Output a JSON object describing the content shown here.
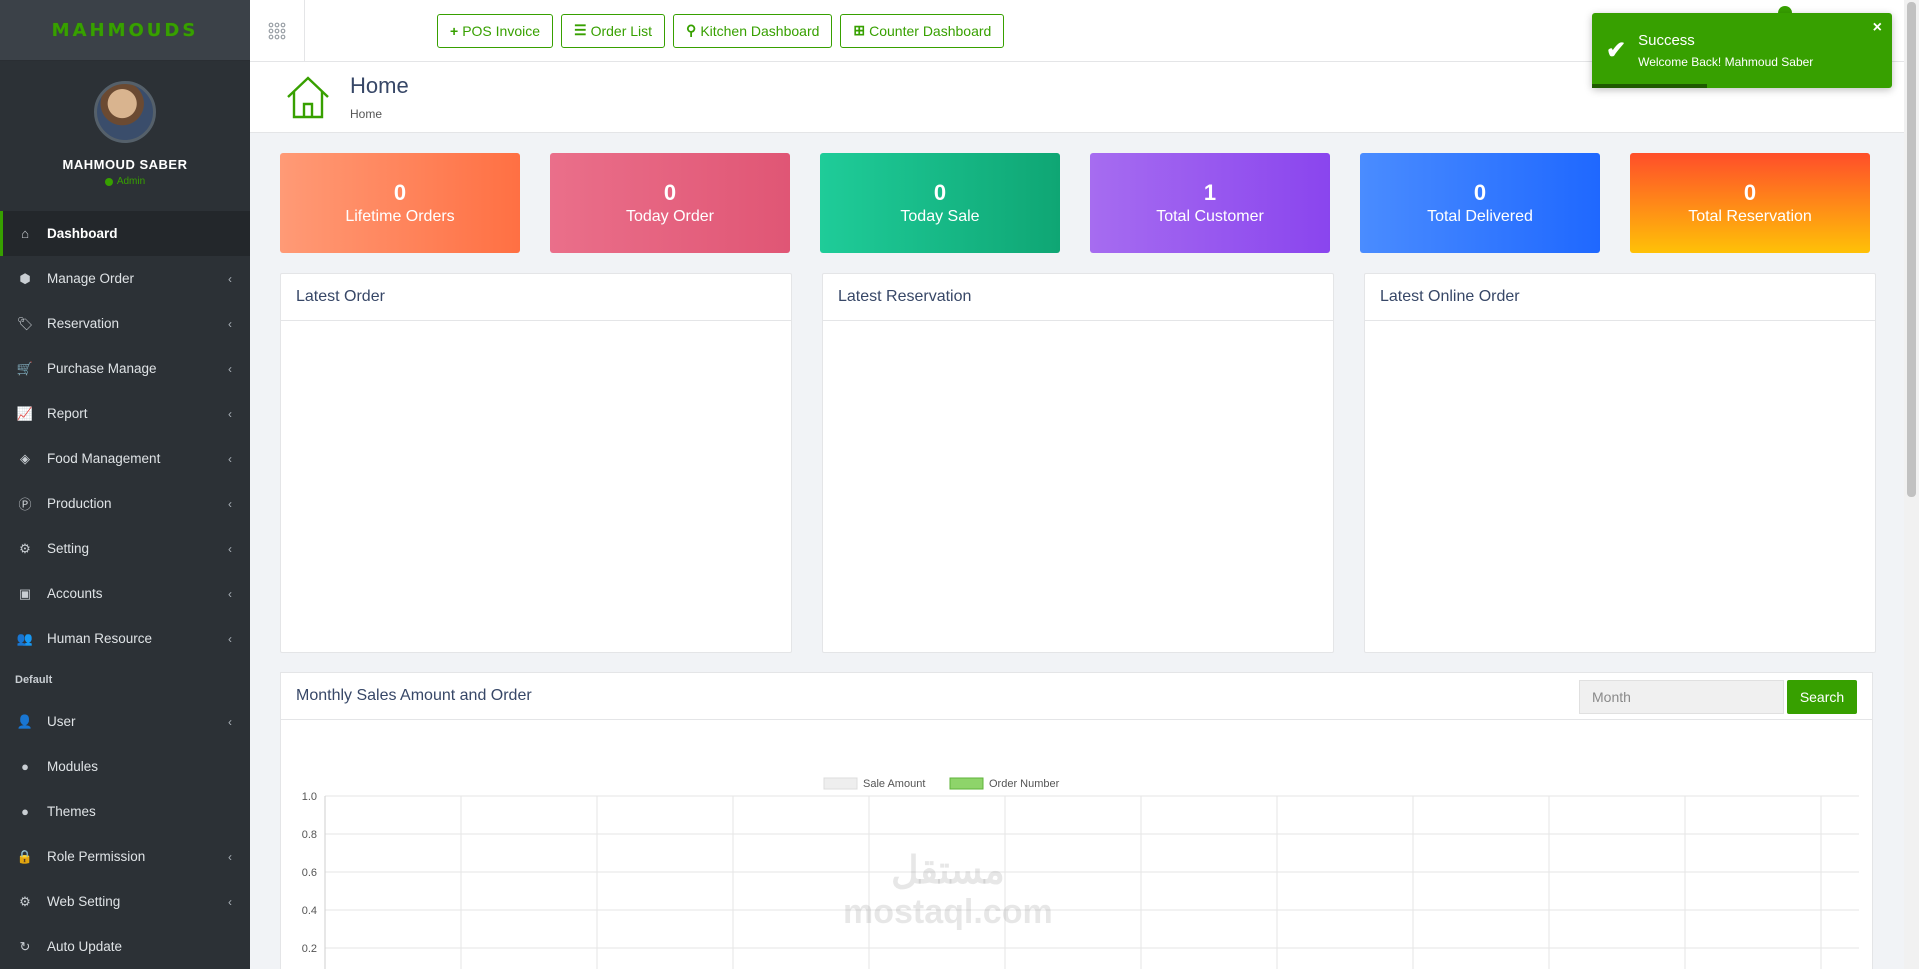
{
  "brand": {
    "logo": "MAHMOUDS"
  },
  "user": {
    "name": "MAHMOUD SABER",
    "role": "Admin"
  },
  "sidebar": {
    "items": [
      {
        "label": "Dashboard",
        "icon": "home-icon",
        "glyph": "⌂",
        "chevron": false,
        "active": true
      },
      {
        "label": "Manage Order",
        "icon": "box-icon",
        "glyph": "⬢",
        "chevron": true
      },
      {
        "label": "Reservation",
        "icon": "tags-icon",
        "glyph": "🏷",
        "chevron": true
      },
      {
        "label": "Purchase Manage",
        "icon": "cart-icon",
        "glyph": "🛒",
        "chevron": true
      },
      {
        "label": "Report",
        "icon": "line-chart-icon",
        "glyph": "📈",
        "chevron": true
      },
      {
        "label": "Food Management",
        "icon": "cube-icon",
        "glyph": "◈",
        "chevron": true
      },
      {
        "label": "Production",
        "icon": "production-icon",
        "glyph": "Ⓟ",
        "chevron": true
      },
      {
        "label": "Setting",
        "icon": "gear-icon",
        "glyph": "⚙",
        "chevron": true
      },
      {
        "label": "Accounts",
        "icon": "briefcase-icon",
        "glyph": "▣",
        "chevron": true
      },
      {
        "label": "Human Resource",
        "icon": "users-icon",
        "glyph": "👥",
        "chevron": true
      }
    ],
    "section_label": "Default",
    "default_items": [
      {
        "label": "User",
        "icon": "user-icon",
        "glyph": "👤",
        "chevron": true
      },
      {
        "label": "Modules",
        "icon": "module-icon",
        "glyph": "●",
        "chevron": false
      },
      {
        "label": "Themes",
        "icon": "theme-icon",
        "glyph": "●",
        "chevron": false
      },
      {
        "label": "Role Permission",
        "icon": "lock-icon",
        "glyph": "🔒",
        "chevron": true
      },
      {
        "label": "Web Setting",
        "icon": "cog-icon",
        "glyph": "⚙",
        "chevron": true
      },
      {
        "label": "Auto Update",
        "icon": "refresh-icon",
        "glyph": "↻",
        "chevron": false
      }
    ]
  },
  "topbar": {
    "buttons": [
      {
        "label": "POS Invoice",
        "icon": "plus-icon",
        "glyph": "+"
      },
      {
        "label": "Order List",
        "icon": "list-icon",
        "glyph": "☰"
      },
      {
        "label": "Kitchen Dashboard",
        "icon": "user-outline-icon",
        "glyph": "⚲"
      },
      {
        "label": "Counter Dashboard",
        "icon": "grid-icon",
        "glyph": "⊞"
      }
    ]
  },
  "toast": {
    "title": "Success",
    "message": "Welcome Back! Mahmoud Saber",
    "close": "×"
  },
  "page": {
    "title": "Home",
    "breadcrumb": "Home"
  },
  "stats": [
    {
      "value": "0",
      "label": "Lifetime Orders",
      "colors": [
        "#ff9a76",
        "#ff7043"
      ]
    },
    {
      "value": "0",
      "label": "Today Order",
      "colors": [
        "#ea6f8a",
        "#e05675"
      ]
    },
    {
      "value": "0",
      "label": "Today Sale",
      "colors": [
        "#1fcc99",
        "#0fa674"
      ]
    },
    {
      "value": "1",
      "label": "Total Customer",
      "colors": [
        "#a66cf0",
        "#8a45ee"
      ]
    },
    {
      "value": "0",
      "label": "Total Delivered",
      "colors": [
        "#4a8cff",
        "#1f68ff"
      ]
    },
    {
      "value": "0",
      "label": "Total Reservation",
      "colors": [
        "#ff4e2a",
        "#ffc107"
      ]
    }
  ],
  "panels": {
    "latest_order": "Latest Order",
    "latest_reservation": "Latest Reservation",
    "latest_online_order": "Latest Online Order"
  },
  "sales_chart": {
    "heading": "Monthly Sales Amount and Order",
    "month_placeholder": "Month",
    "search_label": "Search"
  },
  "chart_data": {
    "type": "bar",
    "categories": [
      "",
      "",
      "",
      "",
      "",
      "",
      "",
      "",
      "",
      "",
      "",
      ""
    ],
    "series": [
      {
        "name": "Sale Amount",
        "values": [],
        "color": "#eeeeee"
      },
      {
        "name": "Order Number",
        "values": [],
        "color": "#8ed46a"
      }
    ],
    "ylim": [
      0,
      1.0
    ],
    "yticks": [
      "1.0",
      "0.8",
      "0.6",
      "0.4",
      "0.2"
    ],
    "grid": true,
    "legend": "top-center"
  },
  "watermark": {
    "arabic": "مستقل",
    "latin": "mostaql.com"
  },
  "colors": {
    "accent": "#37a000",
    "sidebar": "#2c3136"
  }
}
